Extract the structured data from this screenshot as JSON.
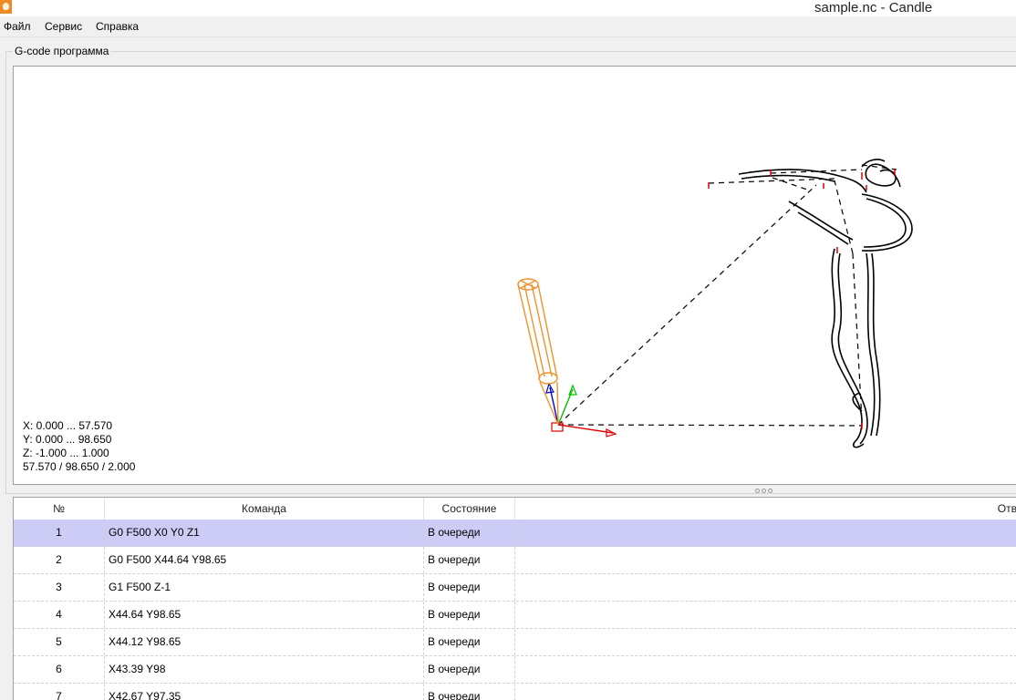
{
  "window": {
    "title": "sample.nc - Candle",
    "icon": "candle-flame-icon",
    "accent": "#f08a24"
  },
  "menu": [
    {
      "label": "Файл"
    },
    {
      "label": "Сервис"
    },
    {
      "label": "Справка"
    }
  ],
  "group": {
    "title": "G-code программа"
  },
  "viewer": {
    "x_range": "X: 0.000 ... 57.570",
    "y_range": "Y: 0.000 ... 98.650",
    "z_range": "Z: -1.000 ... 1.000",
    "size": "57.570 / 98.650 / 2.000",
    "tool_color": "#f0922b"
  },
  "table": {
    "columns": [
      "№",
      "Команда",
      "Состояние",
      "Отв"
    ],
    "selected_color": "#ccccf7",
    "rows": [
      {
        "num": "1",
        "command": "G0 F500 X0 Y0 Z1",
        "state": "В очереди",
        "response": ""
      },
      {
        "num": "2",
        "command": "G0 F500 X44.64 Y98.65",
        "state": "В очереди",
        "response": ""
      },
      {
        "num": "3",
        "command": "G1 F500 Z-1",
        "state": "В очереди",
        "response": ""
      },
      {
        "num": "4",
        "command": "X44.64 Y98.65",
        "state": "В очереди",
        "response": ""
      },
      {
        "num": "5",
        "command": "X44.12 Y98.65",
        "state": "В очереди",
        "response": ""
      },
      {
        "num": "6",
        "command": "X43.39 Y98",
        "state": "В очереди",
        "response": ""
      },
      {
        "num": "7",
        "command": "X42.67 Y97.35",
        "state": "В очереди",
        "response": ""
      }
    ]
  }
}
